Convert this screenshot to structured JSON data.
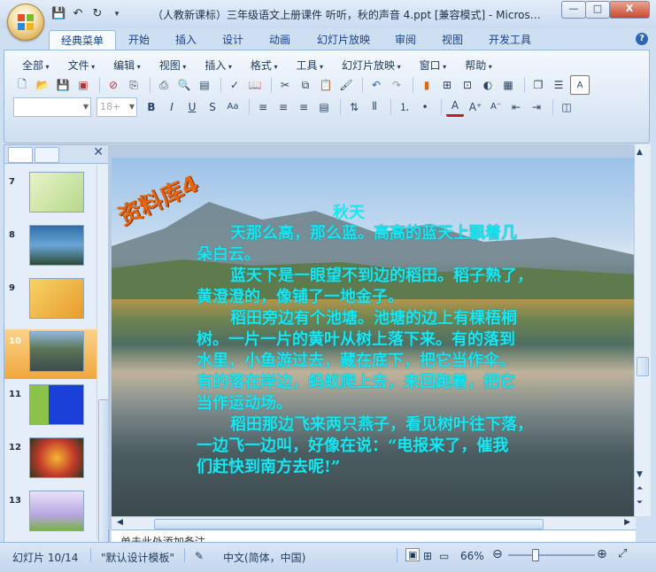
{
  "window": {
    "title": "（人教新课标）三年级语文上册课件 听听，秋的声音 4.ppt [兼容模式] - Micros…",
    "buttons": {
      "minimize": "—",
      "maximize": "□",
      "close": "X"
    }
  },
  "ribbon": {
    "tabs": [
      "经典菜单",
      "开始",
      "插入",
      "设计",
      "动画",
      "幻灯片放映",
      "审阅",
      "视图",
      "开发工具"
    ],
    "active_tab": "经典菜单",
    "menus": [
      "全部",
      "文件",
      "编辑",
      "视图",
      "插入",
      "格式",
      "工具",
      "幻灯片放映",
      "窗口",
      "帮助"
    ],
    "font_name": "",
    "font_size_placeholder": "18+",
    "format_buttons": [
      "B",
      "I",
      "U",
      "S",
      "Aa"
    ],
    "font_color_button": "A"
  },
  "slides_panel": {
    "thumbnails": [
      {
        "number": "7"
      },
      {
        "number": "8"
      },
      {
        "number": "9"
      },
      {
        "number": "10",
        "selected": true
      },
      {
        "number": "11"
      },
      {
        "number": "12"
      },
      {
        "number": "13"
      }
    ]
  },
  "slide": {
    "stamp": "资料库4",
    "title": "秋天",
    "lines": [
      "天那么高，那么蓝。高高的蓝天上飘着几",
      "朵白云。",
      "蓝天下是一眼望不到边的稻田。稻子熟了，",
      "黄澄澄的，像铺了一地金子。",
      "稻田旁边有个池塘。池塘的边上有棵梧桐",
      "树。一片一片的黄叶从树上落下来。有的落到",
      "水里，小鱼游过去，藏在底下，把它当作伞。",
      "有的落在岸边，蚂蚁爬上去，来回跑着，把它",
      "当作运动场。",
      "稻田那边飞来两只燕子，看见树叶往下落，",
      "一边飞一边叫，好像在说：“电报来了，催我",
      "们赶快到南方去呢!”"
    ]
  },
  "notes": "单击此处添加备注",
  "status_bar": {
    "slide_counter": "幻灯片 10/14",
    "theme": "\"默认设计模板\"",
    "language": "中文(简体，中国)",
    "zoom": "66%",
    "zoom_level": 0.66
  }
}
